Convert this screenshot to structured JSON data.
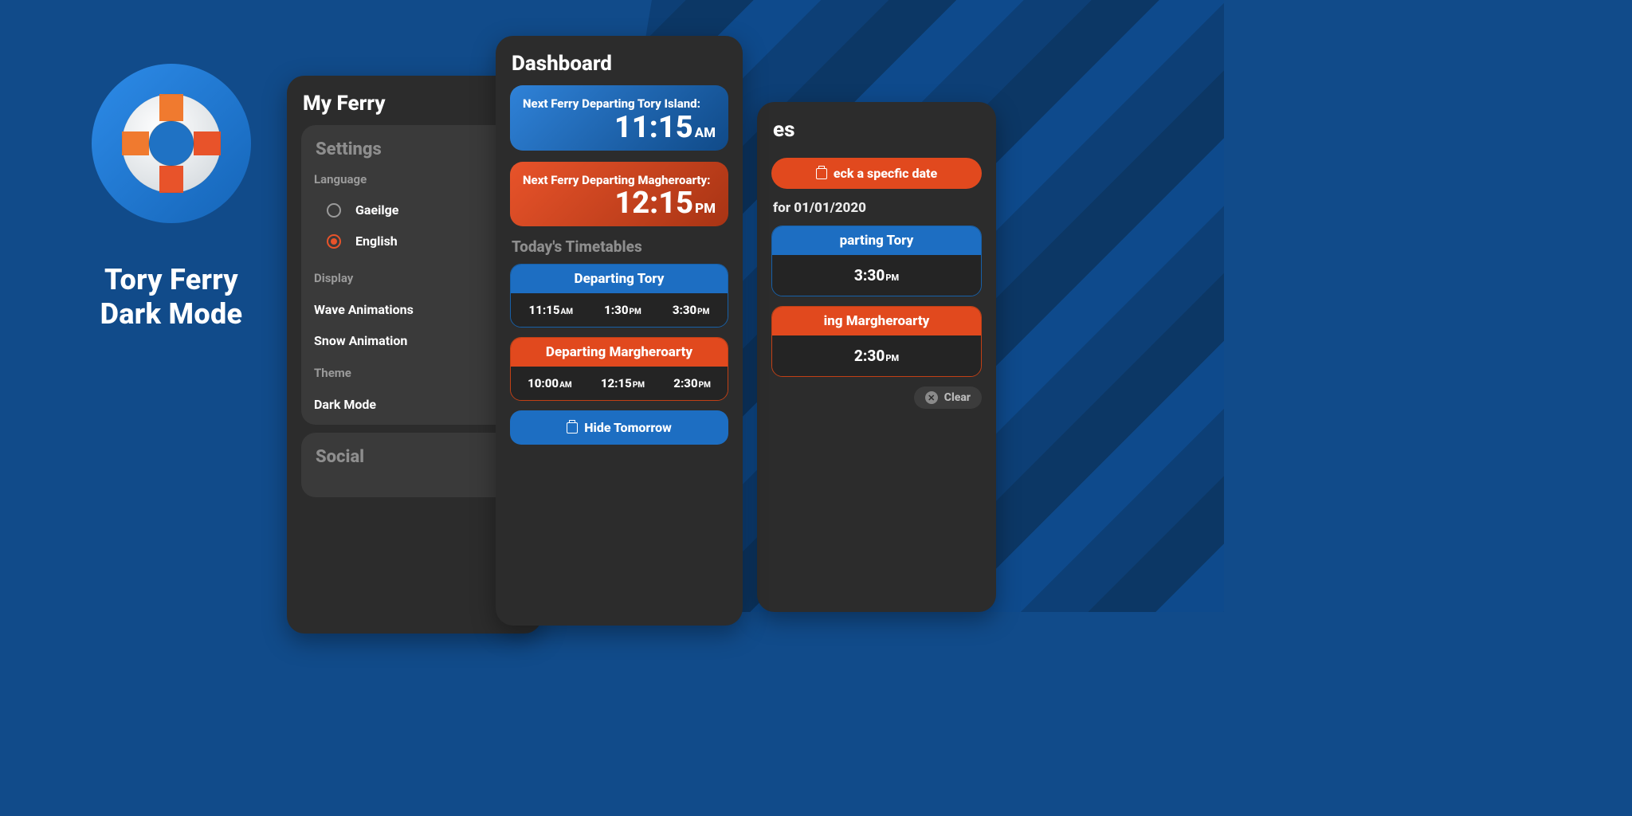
{
  "brand": {
    "title_line1": "Tory Ferry",
    "title_line2": "Dark Mode"
  },
  "settings": {
    "title": "My Ferry",
    "section": "Settings",
    "language": {
      "label": "Language",
      "options": [
        {
          "label": "Gaeilge",
          "selected": false
        },
        {
          "label": "English",
          "selected": true
        }
      ]
    },
    "display": {
      "label": "Display",
      "toggles": [
        {
          "label": "Wave Animations",
          "on": true
        },
        {
          "label": "Snow Animation",
          "on": false
        }
      ]
    },
    "theme": {
      "label": "Theme",
      "toggles": [
        {
          "label": "Dark Mode",
          "on": true
        }
      ]
    },
    "social_section": "Social"
  },
  "dashboard": {
    "title": "Dashboard",
    "next": [
      {
        "label": "Next Ferry Departing Tory Island:",
        "time": "11:15",
        "ampm": "AM",
        "color": "blue"
      },
      {
        "label": "Next Ferry Departing Magheroarty:",
        "time": "12:15",
        "ampm": "PM",
        "color": "orange"
      }
    ],
    "today_heading": "Today's Timetables",
    "tables": [
      {
        "heading": "Departing Tory",
        "color": "blue",
        "times": [
          {
            "t": "11:15",
            "s": "AM"
          },
          {
            "t": "1:30",
            "s": "PM"
          },
          {
            "t": "3:30",
            "s": "PM"
          }
        ]
      },
      {
        "heading": "Departing Margheroarty",
        "color": "orange",
        "times": [
          {
            "t": "10:00",
            "s": "AM"
          },
          {
            "t": "12:15",
            "s": "PM"
          },
          {
            "t": "2:30",
            "s": "PM"
          }
        ]
      }
    ],
    "hide_tomorrow": "Hide Tomorrow"
  },
  "timetables": {
    "title_suffix": "es",
    "check_date": "eck a specfic date",
    "for_date": "for 01/01/2020",
    "tables": [
      {
        "heading": "parting Tory",
        "color": "blue",
        "time": {
          "t": "3:30",
          "s": "PM"
        }
      },
      {
        "heading": "ing Margheroarty",
        "color": "orange",
        "time": {
          "t": "2:30",
          "s": "PM"
        }
      }
    ],
    "clear": "Clear"
  }
}
